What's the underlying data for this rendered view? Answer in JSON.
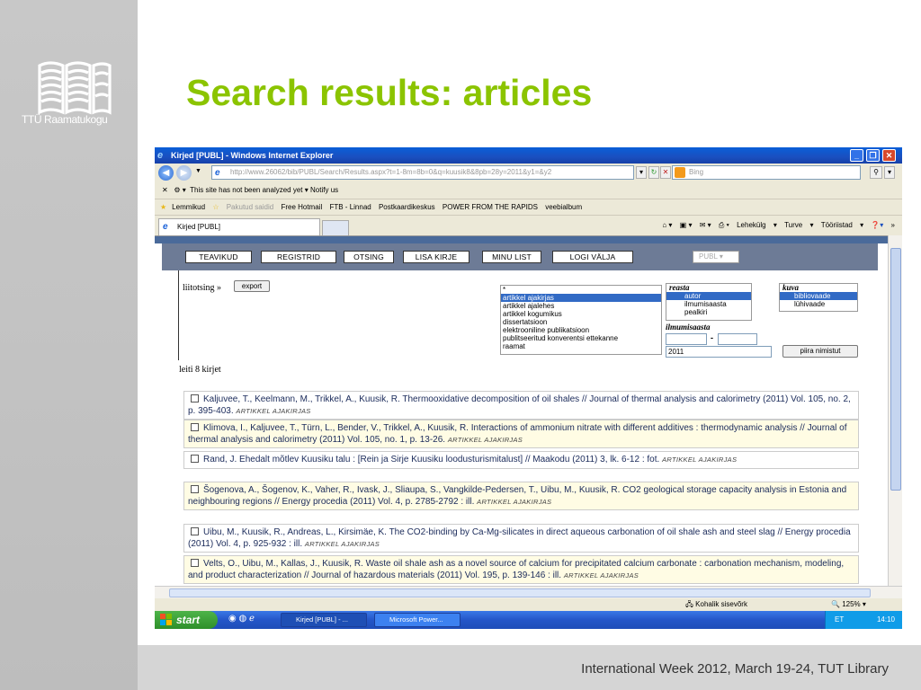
{
  "slide": {
    "title": "Search results: articles",
    "footer": "International Week 2012, March 19-24, TUT Library",
    "logo_text": "TTÜ Raamatukogu",
    "colors": {
      "title": "#8bc400",
      "band": "#c4c4c4"
    }
  },
  "window": {
    "title": "Kirjed [PUBL] - Windows Internet Explorer",
    "address_prefix": "http://www.",
    "address": "26062/bib/PUBL/Search/Results.aspx?t=1-8m=8b=0&q=kuusik8&8pb=28y=2011&y1=&y2",
    "search_placeholder": "Bing",
    "security_text": "This site has not been analyzed yet",
    "notify_text": "Notify us",
    "favorites_label": "Lemmikud",
    "favorites": [
      "Pakutud saidid",
      "Free Hotmail",
      "FTB - Linnad",
      "Postkaardikeskus",
      "POWER FROM THE RAPIDS",
      "veebialbum"
    ],
    "tab_title": "Kirjed [PUBL]",
    "cmd": {
      "page": "Lehekülg",
      "safety": "Turve",
      "tools": "Tööriistad"
    },
    "status_zone": "Kohalik sisevõrk",
    "zoom": "125%"
  },
  "page": {
    "menu": [
      "TEAVIKUD",
      "REGISTRID",
      "OTSING",
      "LISA KIRJE",
      "MINU LIST",
      "LOGI VÄLJA"
    ],
    "db_select": "PUBL",
    "liitotsing": "liitotsing »",
    "export": "export",
    "type_first": "*",
    "types": [
      {
        "label": "artikkel ajakirjas",
        "selected": true
      },
      {
        "label": "artikkel ajalehes",
        "selected": false
      },
      {
        "label": "artikkel kogumikus",
        "selected": false
      },
      {
        "label": "dissertatsioon",
        "selected": false
      },
      {
        "label": "elektrooniline publikatsioon",
        "selected": false
      },
      {
        "label": "publitseeritud konverentsi ettekanne",
        "selected": false
      },
      {
        "label": "raamat",
        "selected": false
      }
    ],
    "order_label": "reasta",
    "order_options": [
      {
        "label": "autor",
        "selected": true
      },
      {
        "label": "ilmumisaasta",
        "selected": false
      },
      {
        "label": "pealkiri",
        "selected": false
      }
    ],
    "view_label": "kuva",
    "view_options": [
      {
        "label": "bibliovaade",
        "selected": true
      },
      {
        "label": "lühivaade",
        "selected": false
      }
    ],
    "year_label": "ilmumisaasta",
    "year_dash": "-",
    "year_value": "2011",
    "limit_button": "piira nimistut",
    "found": "leiti 8 kirjet",
    "results": [
      {
        "text": "Kaljuvee, T., Keelmann, M., Trikkel, A., Kuusik, R. Thermooxidative decomposition of oil shales // Journal of thermal analysis and calorimetry (2011) Vol. 105, no. 2, p. 395-403.",
        "tag": "ARTIKKEL AJAKIRJAS"
      },
      {
        "text": "Klimova, I., Kaljuvee, T., Türn, L., Bender, V., Trikkel, A., Kuusik, R. Interactions of ammonium nitrate with different additives : thermodynamic analysis // Journal of thermal analysis and calorimetry (2011) Vol. 105, no. 1, p. 13-26.",
        "tag": "ARTIKKEL AJAKIRJAS"
      },
      {
        "text": "Rand, J. Ehedalt mõtlev Kuusiku talu : [Rein ja Sirje Kuusiku loodusturismitalust] // Maakodu (2011) 3, lk. 6-12 : fot.",
        "tag": "ARTIKKEL AJAKIRJAS"
      },
      {
        "text": "Šogenova, A., Šogenov, K., Vaher, R., Ivask, J., Sliaupa, S., Vangkilde-Pedersen, T., Uibu, M., Kuusik, R. CO2 geological storage capacity analysis in Estonia and neighbouring regions // Energy procedia (2011) Vol. 4, p. 2785-2792 : ill.",
        "tag": "ARTIKKEL AJAKIRJAS"
      },
      {
        "text": "Uibu, M., Kuusik, R., Andreas, L., Kirsimäe, K. The CO2-binding by Ca-Mg-silicates in direct aqueous carbonation of oil shale ash and steel slag // Energy procedia (2011) Vol. 4, p. 925-932 : ill.",
        "tag": "ARTIKKEL AJAKIRJAS"
      },
      {
        "text": "Velts, O., Uibu, M., Kallas, J., Kuusik, R. Waste oil shale ash as a novel source of calcium for precipitated calcium carbonate : carbonation mechanism, modeling, and product characterization // Journal of hazardous materials (2011) Vol. 195, p. 139-146 : ill.",
        "tag": "ARTIKKEL AJAKIRJAS"
      }
    ]
  },
  "taskbar": {
    "start": "start",
    "tasks": [
      "Kirjed [PUBL] - ...",
      "Microsoft Power..."
    ],
    "lang": "ET",
    "clock": "14:10"
  }
}
